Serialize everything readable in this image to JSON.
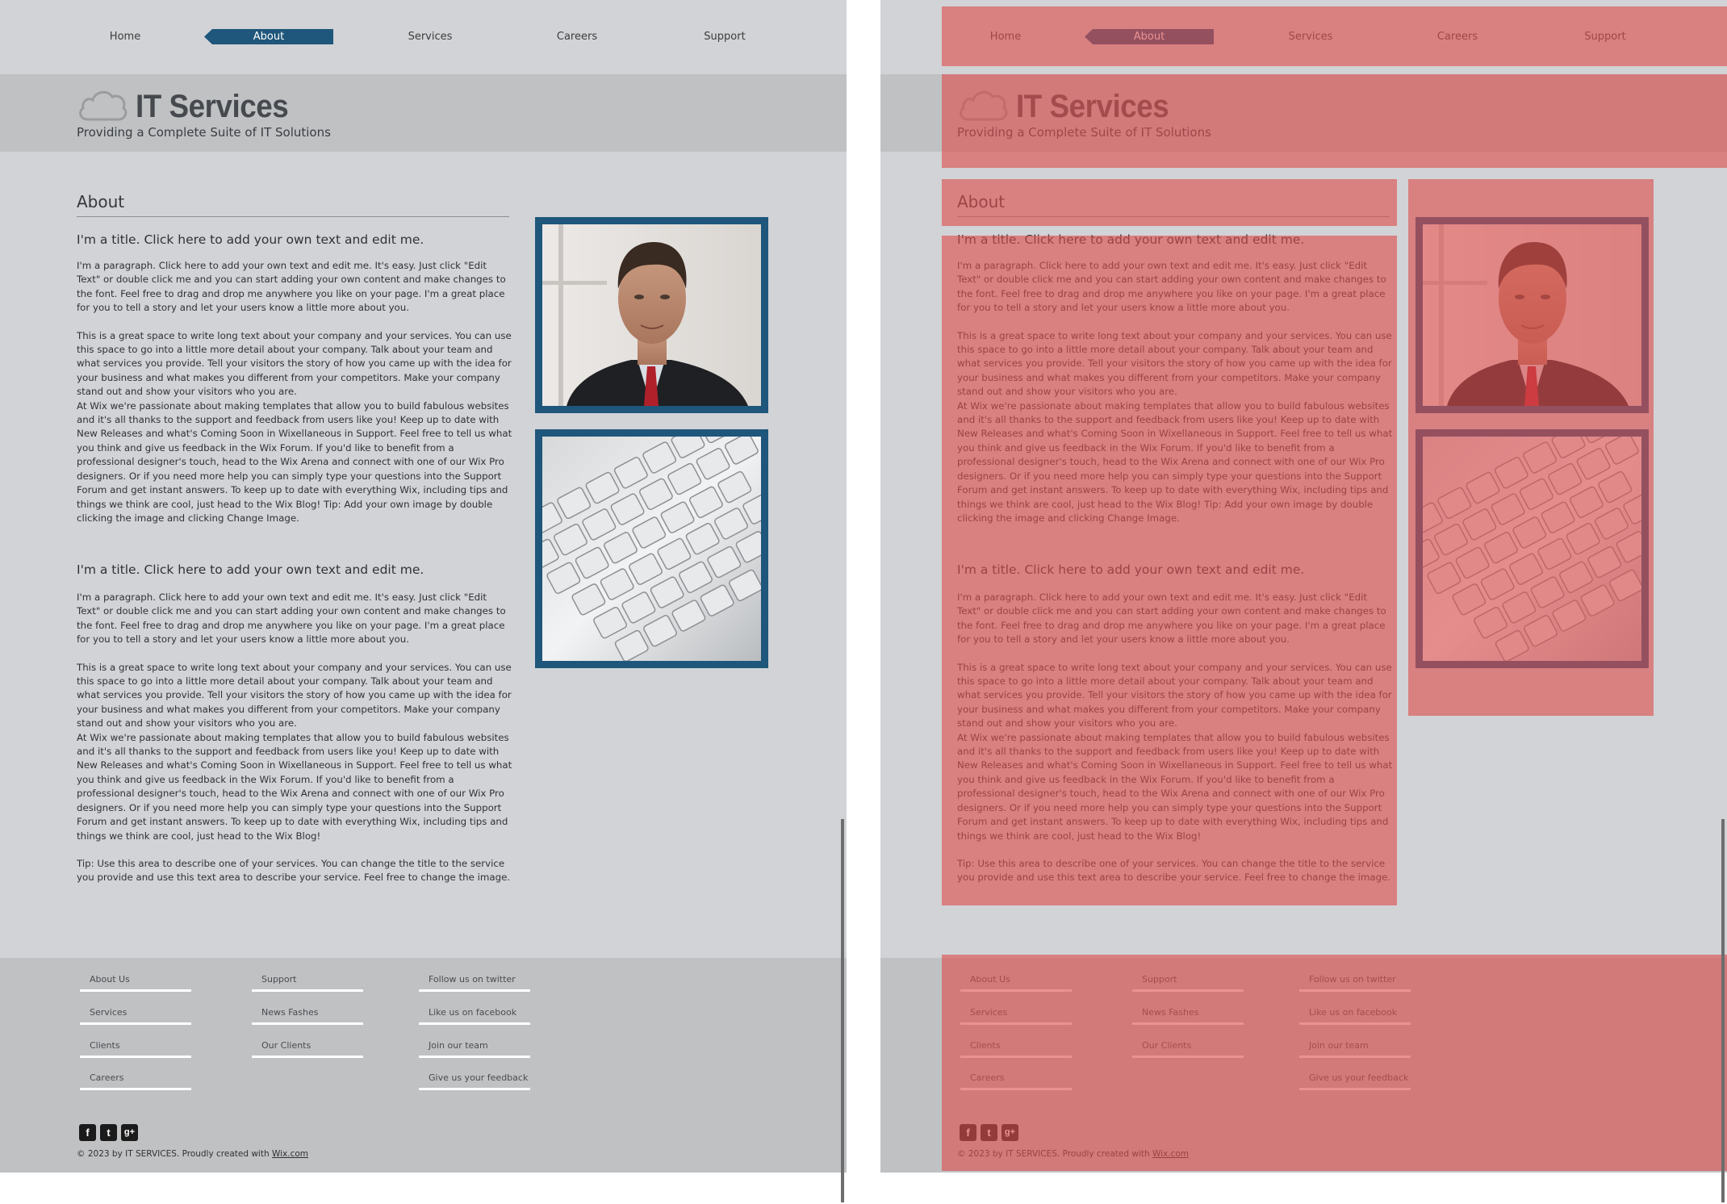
{
  "nav": {
    "items": [
      {
        "label": "Home",
        "active": false
      },
      {
        "label": "About",
        "active": true
      },
      {
        "label": "Services",
        "active": false
      },
      {
        "label": "Careers",
        "active": false
      },
      {
        "label": "Support",
        "active": false
      }
    ]
  },
  "header": {
    "title": "IT Services",
    "tagline": "Providing a Complete Suite of IT Solutions"
  },
  "main": {
    "heading": "About",
    "section1": {
      "title": "I'm a title. Click here to add your own text and edit me.",
      "p1": "I'm a paragraph. Click here to add your own text and edit me. It's easy. Just click \"Edit Text\" or double click me and you can start adding your own content and make changes to the font. Feel free to drag and drop me anywhere you like on your page. I'm a great place for you to tell a story and let your users know a little more about you.",
      "p2": "This is a great space to write long text about your company and your services. You can use this space to go into a little more detail about your company. Talk about your team and what services you provide. Tell your visitors the story of how you came up with the idea for your business and what makes you different from your competitors. Make your company stand out and show your visitors who you are.",
      "p3": "At Wix we're passionate about making templates that allow you to build fabulous websites and it's all thanks to the support and feedback from users like you! Keep up to date with New Releases and what's Coming Soon in Wixellaneous in Support. Feel free to tell us what you think and give us feedback in the Wix Forum. If you'd like to benefit from a professional designer's touch, head to the Wix Arena and connect with one of our Wix Pro designers. Or if you need more help you can simply type your questions into the Support Forum and get instant answers. To keep up to date with everything Wix, including tips and things we think are cool, just head to the Wix Blog! Tip: Add your own image by double clicking the image and clicking Change Image."
    },
    "section2": {
      "title": "I'm a title. Click here to add your own text and edit me.",
      "p1": "I'm a paragraph. Click here to add your own text and edit me. It's easy. Just click \"Edit Text\" or double click me and you can start adding your own content and make changes to the font. Feel free to drag and drop me anywhere you like on your page. I'm a great place for you to tell a story and let your users know a little more about you.",
      "p2": "This is a great space to write long text about your company and your services. You can use this space to go into a little more detail about your company. Talk about your team and what services you provide. Tell your visitors the story of how you came up with the idea for your business and what makes you different from your competitors. Make your company stand out and show your visitors who you are.",
      "p3": "At Wix we're passionate about making templates that allow you to build fabulous websites and it's all thanks to the support and feedback from users like you! Keep up to date with New Releases and what's Coming Soon in Wixellaneous in Support. Feel free to tell us what you think and give us feedback in the Wix Forum. If you'd like to benefit from a professional designer's touch, head to the Wix Arena and connect with one of our Wix Pro designers. Or if you need more help you can simply type your questions into the Support Forum and get instant answers. To keep up to date with everything Wix, including tips and things we think are cool, just head to the Wix Blog!",
      "p4": "Tip: Use this area to describe one of your services. You can change the title to the service you provide and use this text area to describe your service. Feel free to change the image."
    },
    "images": [
      "businessman-portrait",
      "keyboard-closeup"
    ]
  },
  "footer": {
    "col1": [
      "About Us",
      "Services",
      "Clients",
      "Careers"
    ],
    "col2": [
      "Support",
      "News Fashes",
      "Our Clients"
    ],
    "col3": [
      "Follow us on twitter",
      "Like us on facebook",
      "Join our team",
      "Give us your feedback"
    ],
    "social": [
      {
        "icon": "facebook-icon",
        "glyph": "f"
      },
      {
        "icon": "twitter-icon",
        "glyph": "t"
      },
      {
        "icon": "google-plus-icon",
        "glyph": "g+"
      }
    ],
    "copyright_prefix": "© 2023 by IT SERVICES.  Proudly created with ",
    "copyright_link": "Wix.com"
  },
  "colors": {
    "page_bg": "#d1d3d6",
    "band_bg": "#bfc1c3",
    "accent": "#1f567b",
    "overlay": "#dd4d4d"
  }
}
